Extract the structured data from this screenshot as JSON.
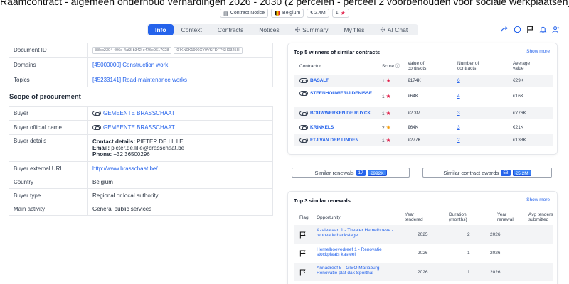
{
  "title": "Raamcontract - algemeen onderhoud verhardingen 2026 - 2030 (2 percelen - perceel 2 voorbehouden voor sociale werkplaatsen)",
  "meta": {
    "notice": "Contract Notice",
    "country": "Belgium",
    "value": "€ 2.4M",
    "score": "1"
  },
  "nav": {
    "tabs": [
      "Info",
      "Context",
      "Contracts",
      "Notices",
      "Summary",
      "My files",
      "AI Chat"
    ],
    "active": "Info"
  },
  "details": {
    "rows": [
      {
        "label": "Document ID",
        "id1": "88cb2304-406e-4af3-b342-e476e9617028",
        "id2": "0'IKN0K1900XY9VSFDFPSH0325H"
      },
      {
        "label": "Domains",
        "value": "[45000000] Construction work"
      },
      {
        "label": "Topics",
        "value": "[45233141] Road-maintenance works"
      }
    ],
    "section": "Scope of procurement",
    "scope": {
      "buyer_label": "Buyer",
      "buyer": "GEMEENTE BRASSCHAAT",
      "official_label": "Buyer official name",
      "official": "GEMEENTE BRASSCHAAT",
      "details_label": "Buyer details",
      "contact_key": "Contact details:",
      "contact_val": "PIETER DE LILLE",
      "email_key": "Email:",
      "email_val": "pieter.de.lille@brasschaat.be",
      "phone_key": "Phone:",
      "phone_val": "+32 36500296",
      "url_label": "Buyer external URL",
      "url": "http://www.brasschaat.be/",
      "country_label": "Country",
      "country": "Belgium",
      "type_label": "Buyer type",
      "type": "Regional or local authority",
      "activity_label": "Main activity",
      "activity": "General public services"
    }
  },
  "winners": {
    "title": "Top 5 winners of similar contracts",
    "show_more": "Show more",
    "headers": {
      "contractor": "Contractor",
      "score": "Score",
      "value": "Value of contracts",
      "number": "Number of contracts",
      "avg": "Average value"
    },
    "rows": [
      {
        "name": "BASALT",
        "score": "1",
        "value": "€174K",
        "number": "6",
        "avg": "€29K",
        "star_color": "#e11d48"
      },
      {
        "name": "STEENHOUWERIJ DENISSE",
        "score": "1",
        "value": "€64K",
        "number": "4",
        "avg": "€16K",
        "star_color": "#e11d48"
      },
      {
        "name": "BOUWWERKEN DE RUYCK",
        "score": "1",
        "value": "€2.3M",
        "number": "3",
        "avg": "€776K",
        "star_color": "#e11d48"
      },
      {
        "name": "KRINKELS",
        "score": "2",
        "value": "€64K",
        "number": "3",
        "avg": "€21K",
        "star_color": "#f59e0b"
      },
      {
        "name": "FTJ VAN DER LINDEN",
        "score": "1",
        "value": "€277K",
        "number": "2",
        "avg": "€138K",
        "star_color": "#e11d48"
      }
    ]
  },
  "similar": {
    "renewals_label": "Similar renewals",
    "renewals_count": "17",
    "renewals_value": "€992K",
    "awards_label": "Similar contract awards",
    "awards_count": "58",
    "awards_value": "€5.2M"
  },
  "renewals": {
    "title": "Top 3 similar renewals",
    "show_more": "Show more",
    "headers": {
      "flag": "Flag",
      "opportunity": "Opportunity",
      "tendered": "Year tendered",
      "duration": "Duration (months)",
      "renewal": "Year renewal",
      "avg": "Avg tenders submitted"
    },
    "rows": [
      {
        "opportunity": "Azalealaan 1 - Theater Hemelhoeve - renovatie backstage",
        "tendered": "2025",
        "duration": "2",
        "renewal": "2026"
      },
      {
        "opportunity": "Hemelhoevedreef 1 - Renovatie stockplaats kasteel",
        "tendered": "2026",
        "duration": "1",
        "renewal": "2026"
      },
      {
        "opportunity": "Annadreef 5 - GIBO Mariaburg - Renovatie plat dak Sporthal",
        "tendered": "2026",
        "duration": "1",
        "renewal": "2026"
      }
    ]
  }
}
